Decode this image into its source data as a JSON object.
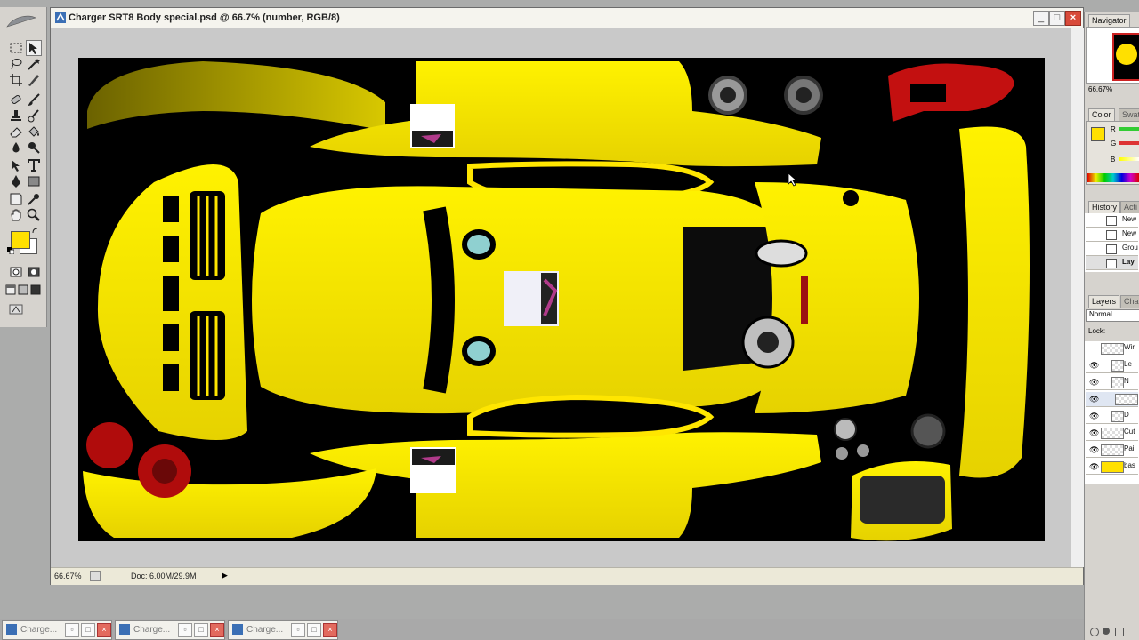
{
  "document": {
    "title": "Charger SRT8 Body special.psd @ 66.7% (number, RGB/8)",
    "zoom": "66.67%",
    "doc_size": "Doc: 6.00M/29.9M"
  },
  "navigator": {
    "tab": "Navigator",
    "zoom": "66.67%"
  },
  "color_panel": {
    "tabs": [
      "Color",
      "Swatc"
    ],
    "channels": [
      "R",
      "G",
      "B"
    ],
    "foreground": "#ffe000",
    "background": "#ffffff"
  },
  "history_panel": {
    "tabs": [
      "History",
      "Acti"
    ],
    "items": [
      "New",
      "New",
      "Grou",
      "Lay"
    ]
  },
  "layers_panel": {
    "tabs": [
      "Layers",
      "Char"
    ],
    "blend_mode": "Normal",
    "lock_label": "Lock:",
    "layers": [
      "Wir",
      "Le",
      "N",
      "",
      "D",
      "Cut",
      "Pai",
      "bas"
    ]
  },
  "taskbar": {
    "items": [
      "Charge...",
      "Charge...",
      "Charge..."
    ]
  },
  "colors": {
    "paint": "#ffe600",
    "paint_dark": "#8a7d00",
    "accent_red": "#cc1111"
  }
}
